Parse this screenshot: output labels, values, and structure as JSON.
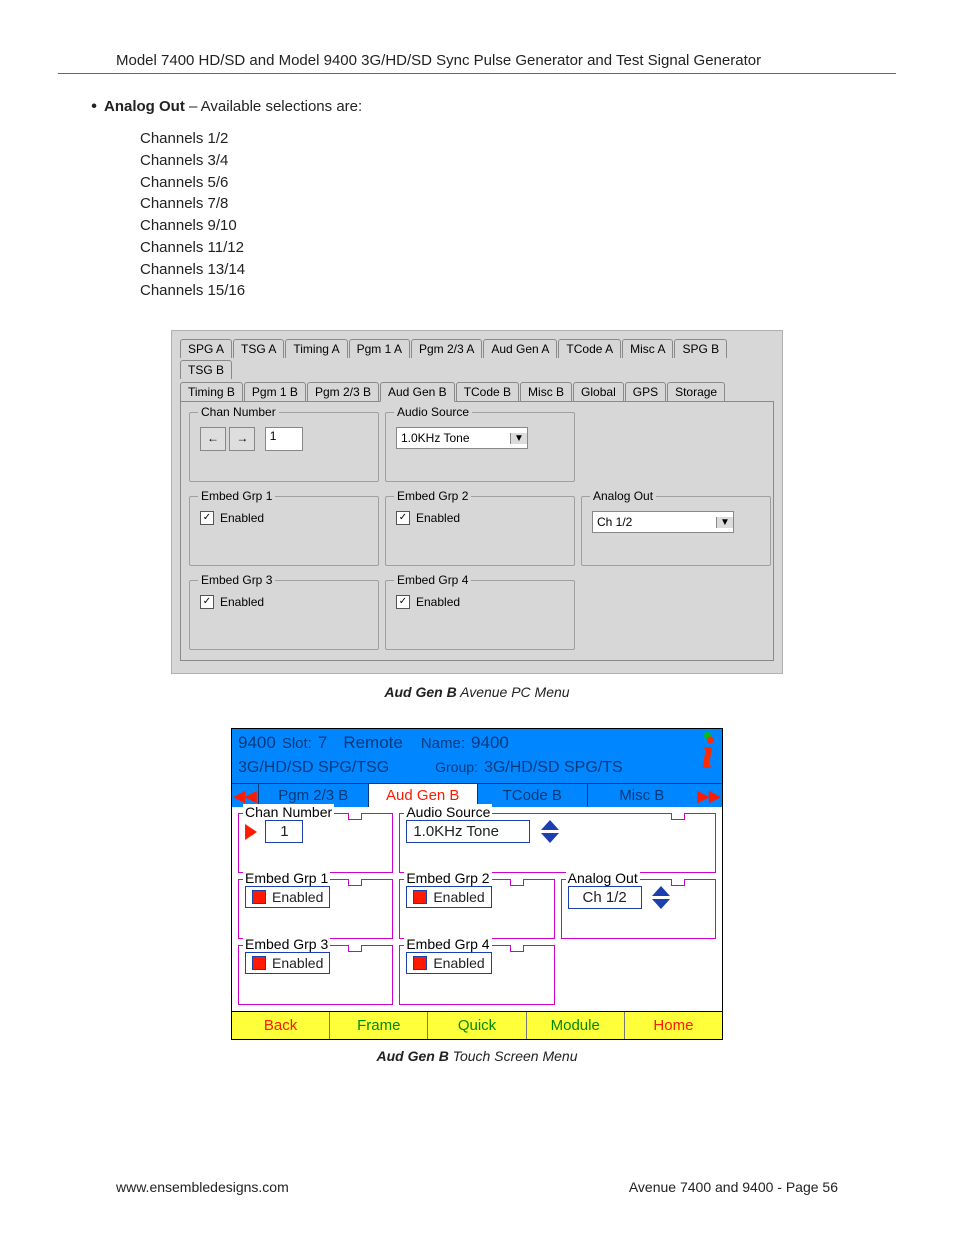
{
  "header": "Model 7400 HD/SD and Model 9400 3G/HD/SD Sync Pulse Generator and Test Signal Generator",
  "bullet": {
    "label": "Analog Out",
    "tail": " – Available selections are:"
  },
  "channels": [
    "Channels 1/2",
    "Channels 3/4",
    "Channels 5/6",
    "Channels 7/8",
    "Channels 9/10",
    "Channels 11/12",
    "Channels 13/14",
    "Channels 15/16"
  ],
  "pcmenu": {
    "tabs_row1": [
      "SPG A",
      "TSG A",
      "Timing A",
      "Pgm 1 A",
      "Pgm 2/3 A",
      "Aud Gen A",
      "TCode A",
      "Misc A",
      "SPG B",
      "TSG B"
    ],
    "tabs_row2": [
      "Timing B",
      "Pgm 1 B",
      "Pgm 2/3 B",
      "Aud Gen B",
      "TCode B",
      "Misc B",
      "Global",
      "GPS",
      "Storage"
    ],
    "active_tab": "Aud Gen B",
    "chan_number": {
      "title": "Chan Number",
      "value": "1"
    },
    "audio_source": {
      "title": "Audio Source",
      "value": "1.0KHz Tone"
    },
    "embed1": {
      "title": "Embed Grp 1",
      "label": "Enabled",
      "checked": true
    },
    "embed2": {
      "title": "Embed Grp 2",
      "label": "Enabled",
      "checked": true
    },
    "analog_out": {
      "title": "Analog Out",
      "value": "Ch 1/2"
    },
    "embed3": {
      "title": "Embed Grp 3",
      "label": "Enabled",
      "checked": true
    },
    "embed4": {
      "title": "Embed Grp 4",
      "label": "Enabled",
      "checked": true
    }
  },
  "caption1": {
    "bold": "Aud Gen B",
    "rest": " Avenue PC Menu"
  },
  "tsmenu": {
    "top": {
      "model": "9400",
      "slot_k": "Slot:",
      "slot_v": "7",
      "remote": "Remote",
      "name_k": "Name:",
      "name_v": "9400"
    },
    "sub": {
      "left": "3G/HD/SD SPG/TSG",
      "group_k": "Group:",
      "group_v": "3G/HD/SD SPG/TS"
    },
    "tabs": [
      "Pgm 2/3 B",
      "Aud Gen B",
      "TCode B",
      "Misc B"
    ],
    "active_tab": "Aud Gen B",
    "chan_number": {
      "title": "Chan Number",
      "value": "1"
    },
    "audio_source": {
      "title": "Audio Source",
      "value": "1.0KHz Tone"
    },
    "embed1": {
      "title": "Embed Grp 1",
      "label": "Enabled"
    },
    "embed2": {
      "title": "Embed Grp 2",
      "label": "Enabled"
    },
    "analog_out": {
      "title": "Analog Out",
      "value": "Ch 1/2"
    },
    "embed3": {
      "title": "Embed Grp 3",
      "label": "Enabled"
    },
    "embed4": {
      "title": "Embed Grp 4",
      "label": "Enabled"
    },
    "bottom": [
      "Back",
      "Frame",
      "Quick",
      "Module",
      "Home"
    ]
  },
  "caption2": {
    "bold": "Aud Gen B",
    "rest": " Touch Screen Menu"
  },
  "footer": {
    "left": "www.ensembledesigns.com",
    "right": "Avenue 7400 and 9400 - Page 56"
  }
}
